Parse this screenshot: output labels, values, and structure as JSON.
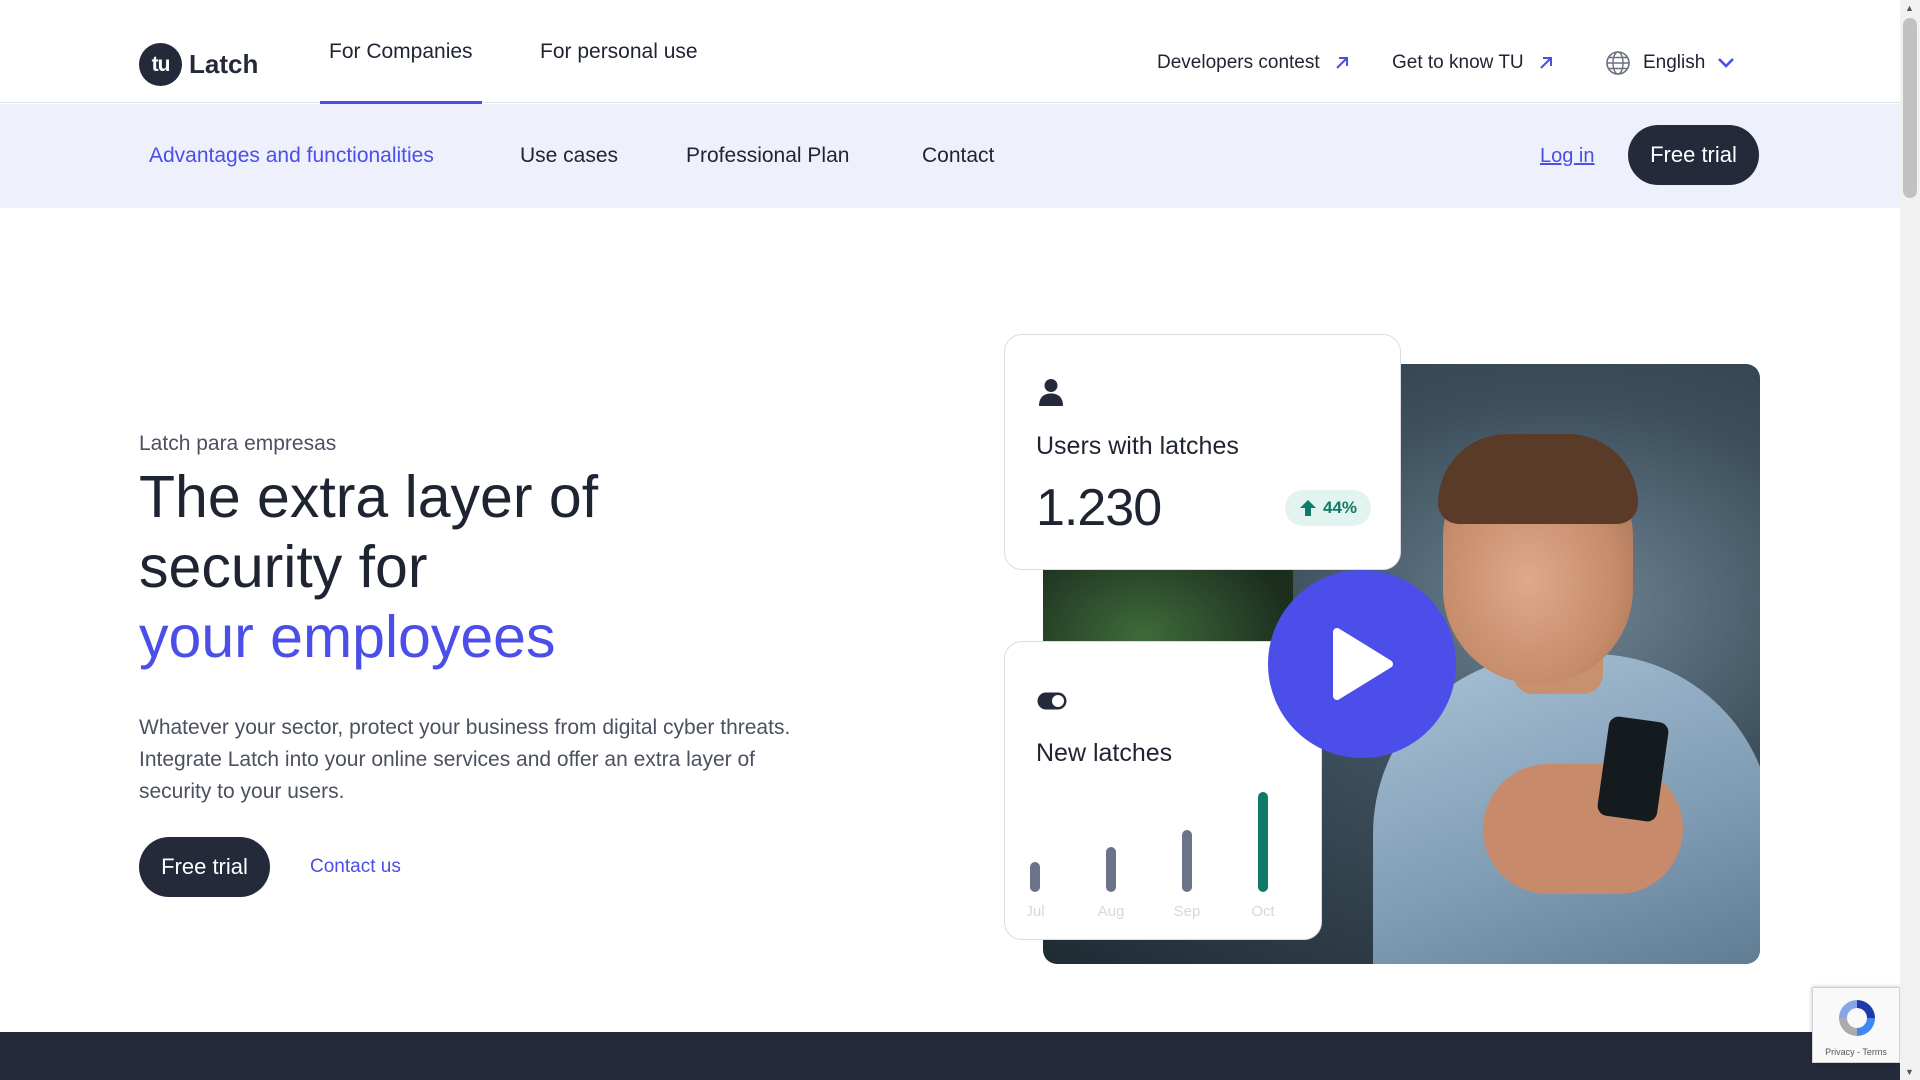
{
  "brand": {
    "logo_mark": "tu",
    "name": "Latch"
  },
  "top_nav": {
    "tabs": [
      {
        "label": "For Companies",
        "active": true
      },
      {
        "label": "For personal use",
        "active": false
      }
    ],
    "external_links": [
      {
        "label": "Developers contest",
        "icon": "arrow-up-right-icon"
      },
      {
        "label": "Get to know TU",
        "icon": "arrow-up-right-icon"
      }
    ],
    "language": {
      "label": "English",
      "icon": "globe-icon"
    }
  },
  "sub_nav": {
    "items": [
      {
        "label": "Advantages and functionalities",
        "active": true
      },
      {
        "label": "Use cases",
        "active": false
      },
      {
        "label": "Professional Plan",
        "active": false
      },
      {
        "label": "Contact",
        "active": false
      }
    ],
    "login_label": "Log in",
    "cta_label": "Free trial"
  },
  "hero": {
    "eyebrow": "Latch para empresas",
    "title_line1": "The extra layer of",
    "title_line2": "security for",
    "title_accent": "your employees",
    "description": "Whatever your sector, protect your business from digital cyber threats. Integrate Latch into your online services and offer an extra layer of security to your users.",
    "primary_cta": "Free trial",
    "secondary_cta": "Contact us"
  },
  "users_card": {
    "icon": "user-icon",
    "title": "Users with latches",
    "value": "1.230",
    "change": "44%",
    "change_icon": "arrow-up-icon"
  },
  "latches_card": {
    "icon": "toggle-icon",
    "title": "New latches"
  },
  "chart_data": {
    "type": "bar",
    "categories": [
      "Jul",
      "Aug",
      "Sep",
      "Oct"
    ],
    "values": [
      30,
      45,
      62,
      100
    ],
    "highlight": "Oct",
    "colors": {
      "default": "#6b7389",
      "highlight": "#0f7a66"
    }
  },
  "video": {
    "icon": "play-icon"
  },
  "recaptcha": {
    "text": "Privacy - Terms"
  },
  "colors": {
    "accent": "#4b4ee8",
    "dark": "#252a3a",
    "subnav_bg": "#eef1fb",
    "positive": "#0f7a66"
  }
}
